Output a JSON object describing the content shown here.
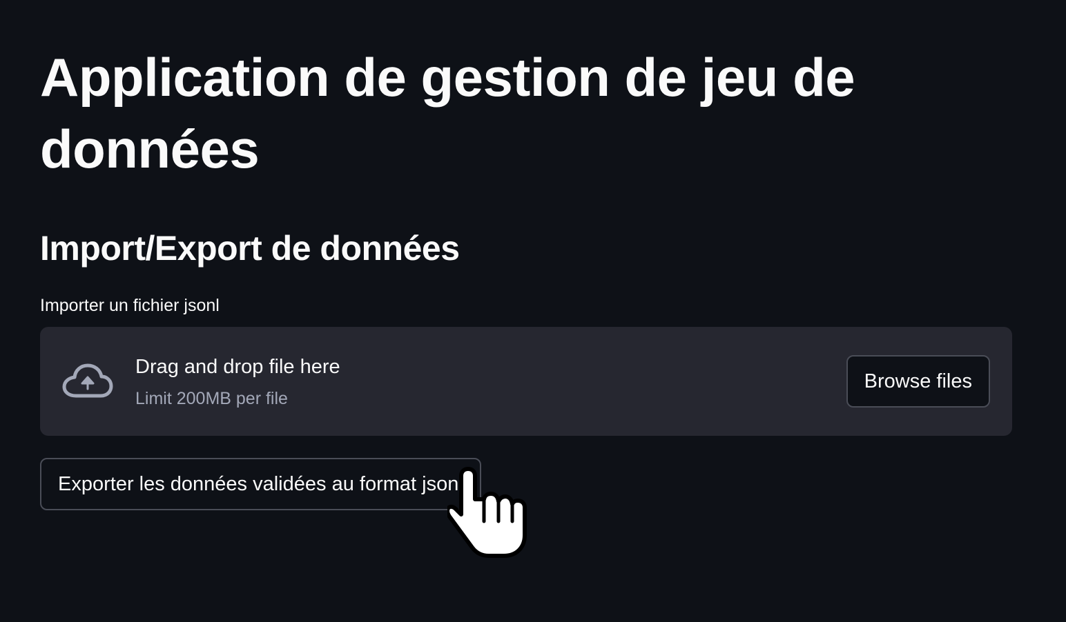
{
  "app": {
    "title": "Application de gestion de jeu de données"
  },
  "section": {
    "title": "Import/Export de données"
  },
  "uploader": {
    "label": "Importer un fichier jsonl",
    "icon": "cloud-upload-icon",
    "drag_text": "Drag and drop file here",
    "limit_text": "Limit 200MB per file",
    "browse_label": "Browse files"
  },
  "export": {
    "button_label": "Exporter les données validées au format jsonl"
  },
  "colors": {
    "background": "#0e1117",
    "dropzone": "#262730",
    "text": "#fafafa",
    "muted_text": "#a3a8b8",
    "border": "#4a4d57"
  }
}
